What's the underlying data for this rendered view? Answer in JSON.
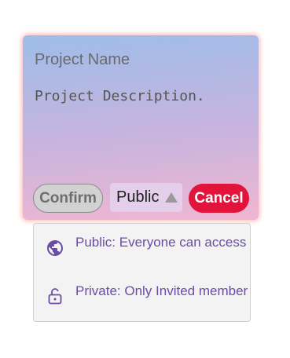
{
  "form": {
    "name_placeholder": "Project Name",
    "name_value": "",
    "description_placeholder": "Project Description.",
    "description_value": "",
    "confirm_label": "Confirm",
    "cancel_label": "Cancel"
  },
  "visibility": {
    "selected": "Public",
    "caret_icon": "caret-up-icon",
    "options": [
      {
        "label": "Public: Everyone can access",
        "icon": "globe-icon"
      },
      {
        "label": "Private: Only Invited member",
        "icon": "lock-icon"
      }
    ]
  },
  "colors": {
    "gradient_top": "#9ebde9",
    "gradient_bottom": "#f0b6d1",
    "card_glow": "#ffaaaa",
    "cancel_button": "#e3143c",
    "confirm_button": "#d2d2d2",
    "option_text": "#6a4da3"
  }
}
